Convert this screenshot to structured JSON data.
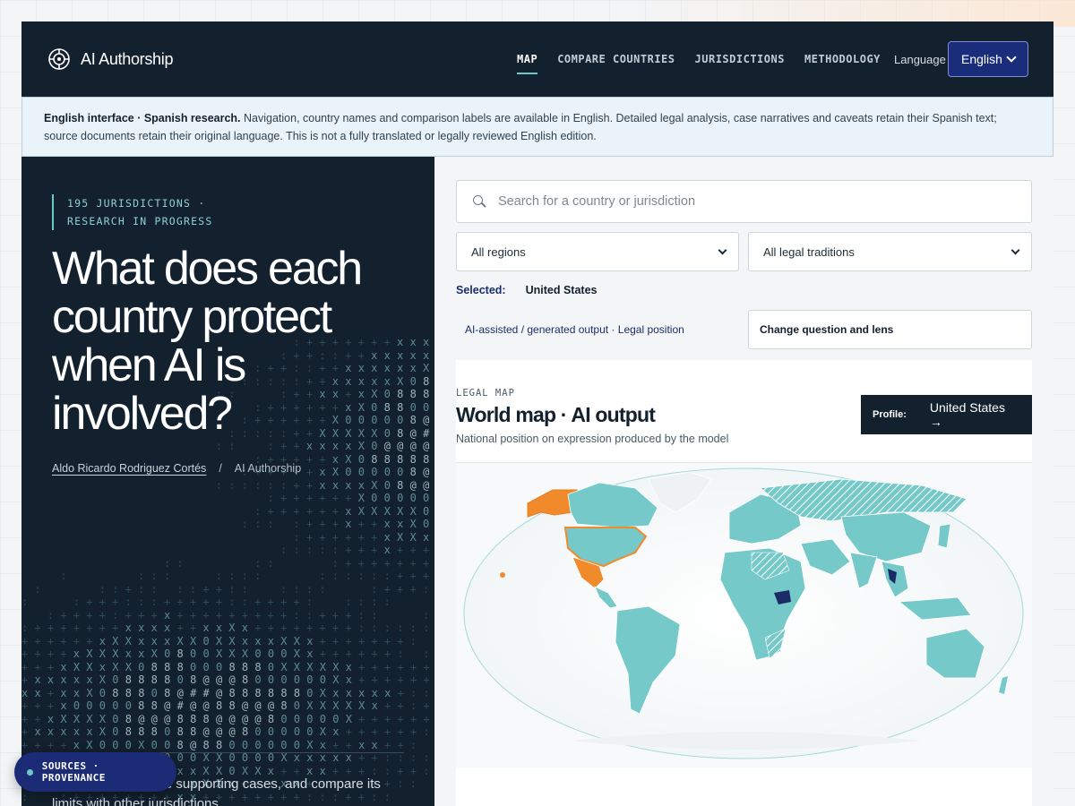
{
  "brand": {
    "name": "AI Authorship",
    "logo_icon": "brand-logo-icon"
  },
  "nav": {
    "items": [
      {
        "label": "MAP",
        "active": true
      },
      {
        "label": "COMPARE COUNTRIES",
        "active": false
      },
      {
        "label": "JURISDICTIONS",
        "active": false
      },
      {
        "label": "METHODOLOGY",
        "active": false
      }
    ],
    "language_label": "Language",
    "language_value": "English"
  },
  "notice": {
    "lead": "English interface · Spanish research.",
    "body": " Navigation, country names and comparison labels are available in English. Detailed legal analysis, case narratives and caveats retain their Spanish text; source documents retain their original language. This is not a fully translated or legally reviewed English edition."
  },
  "hero": {
    "eyebrow": "195 JURISDICTIONS · RESEARCH IN PROGRESS",
    "title": "What does each country protect when AI is involved?",
    "author": "Aldo Ricardo Rodriguez Cortés",
    "separator": "/",
    "site": "AI Authorship",
    "description": "… position, read the supporting cases, and compare its limits with other jurisdictions."
  },
  "filters": {
    "search_placeholder": "Search for a country or jurisdiction",
    "region_value": "All regions",
    "tradition_value": "All legal traditions"
  },
  "selection": {
    "label": "Selected:",
    "value": "United States",
    "lens_text": "AI-assisted / generated output · Legal position",
    "change_button": "Change question and lens"
  },
  "map": {
    "eyebrow": "LEGAL MAP",
    "title": "World map · AI output",
    "subtitle": "National position on expression produced by the model",
    "profile_label": "Profile:",
    "profile_value": "United States →",
    "colors": {
      "default": "#76c9c9",
      "hatched": "#76c9c9",
      "highlight": "#f08a2b",
      "dark": "#1b2b66",
      "ocean_outline": "#a7d9d9"
    }
  },
  "sources_pill": {
    "label": "SOURCES · PROVENANCE",
    "status_color": "#6cc7c7"
  }
}
